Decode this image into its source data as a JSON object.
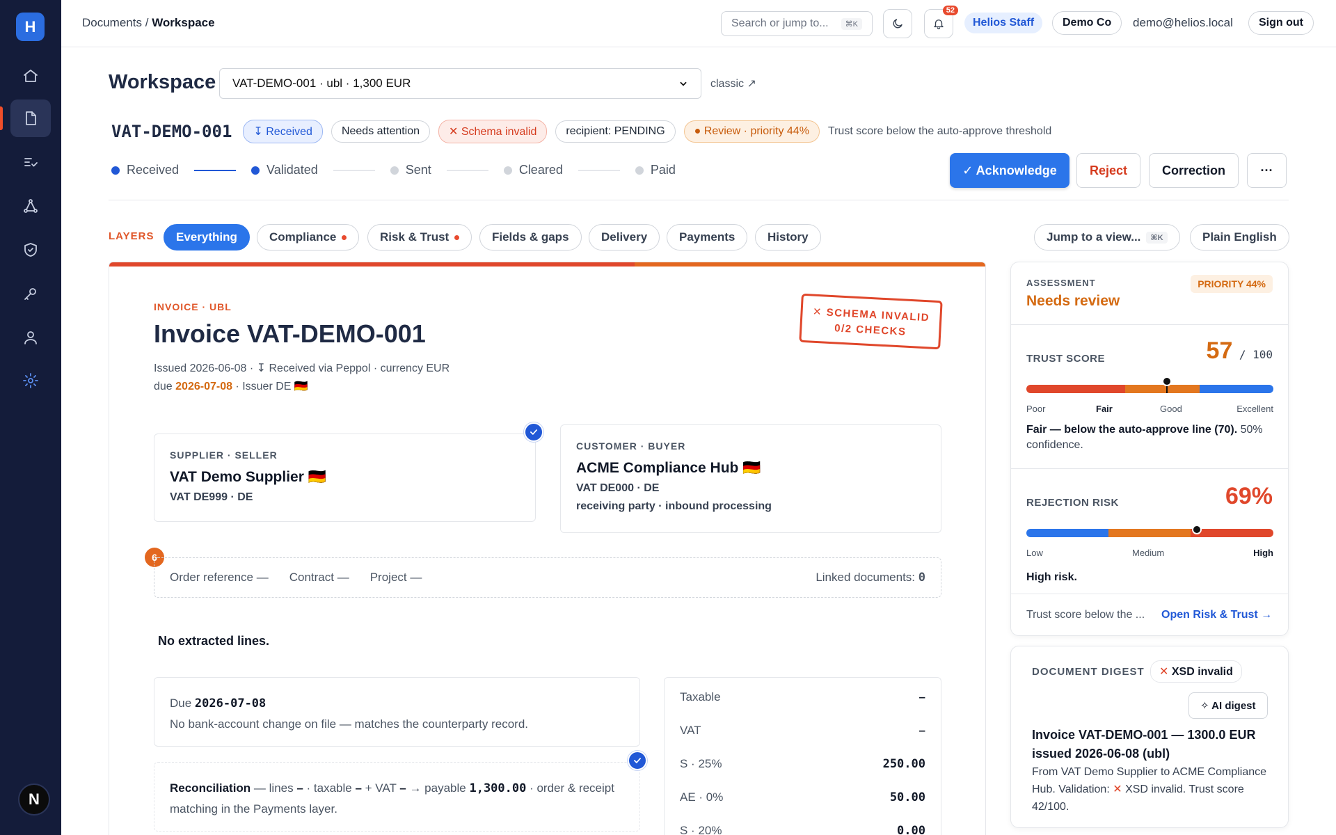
{
  "app": {
    "logo_letter": "H",
    "user_initial": "N"
  },
  "breadcrumb": {
    "parent": "Documents",
    "sep": "/",
    "current": "Workspace"
  },
  "topbar": {
    "search_placeholder": "Search or jump to...",
    "search_kbd": "⌘K",
    "notifications_count": "52",
    "staff_badge": "Helios Staff",
    "org": "Demo Co",
    "email": "demo@helios.local",
    "sign_out": "Sign out"
  },
  "workspace": {
    "title": "Workspace",
    "selected_doc": "VAT-DEMO-001 · ubl · 1,300 EUR",
    "classic_link": "classic ↗"
  },
  "document": {
    "id": "VAT-DEMO-001",
    "chips": {
      "received": "↧ Received",
      "needs_attention": "Needs attention",
      "schema_invalid": "✕ Schema invalid",
      "recipient": "recipient: PENDING",
      "review": "● Review · priority 44%"
    },
    "trust_note": "Trust score below the auto-approve threshold",
    "stages": [
      {
        "label": "Received",
        "done": true
      },
      {
        "label": "Validated",
        "done": true
      },
      {
        "label": "Sent",
        "done": false
      },
      {
        "label": "Cleared",
        "done": false
      },
      {
        "label": "Paid",
        "done": false
      }
    ],
    "actions": {
      "acknowledge": "✓ Acknowledge",
      "reject": "Reject",
      "correction": "Correction",
      "more": "···"
    }
  },
  "layers": {
    "label": "LAYERS",
    "tabs": [
      {
        "label": "Everything",
        "active": true
      },
      {
        "label": "Compliance",
        "alert": true
      },
      {
        "label": "Risk & Trust",
        "alert": true
      },
      {
        "label": "Fields & gaps"
      },
      {
        "label": "Delivery"
      },
      {
        "label": "Payments"
      },
      {
        "label": "History"
      }
    ],
    "jump": "Jump to a view...",
    "jump_kbd": "⌘K",
    "plain_english": "Plain English"
  },
  "invoice": {
    "type_label": "INVOICE · UBL",
    "title": "Invoice VAT-DEMO-001",
    "meta_line1": "Issued 2026-06-08 · ↧ Received via Peppol · currency EUR",
    "due_prefix": "due ",
    "due_date": "2026-07-08",
    "due_suffix": " · Issuer DE 🇩🇪",
    "stamp_line1": "✕ SCHEMA INVALID",
    "stamp_line2": "0/2 CHECKS",
    "supplier": {
      "label": "SUPPLIER · SELLER",
      "name": "VAT Demo Supplier 🇩🇪",
      "vat": "VAT DE999 · DE"
    },
    "customer": {
      "label": "CUSTOMER · BUYER",
      "name": "ACME Compliance Hub 🇩🇪",
      "vat": "VAT DE000 · DE",
      "note": "receiving party · inbound processing"
    },
    "gap_count": "6",
    "refs": {
      "order": "Order reference —",
      "contract": "Contract —",
      "project": "Project —",
      "linked_label": "Linked documents: ",
      "linked_count": "0"
    },
    "no_lines": "No extracted lines.",
    "due_box": {
      "label": "Due ",
      "date": "2026-07-08",
      "note": "No bank-account change on file — matches the counterparty record."
    },
    "reconciliation": {
      "label": "Reconciliation",
      "text1": " — lines ",
      "lines": "–",
      "text2": " · taxable ",
      "taxable": "–",
      "text3": " + VAT ",
      "vat": "–",
      "text4": " → payable ",
      "payable": "1,300.00",
      "text5": " · order & receipt matching in the Payments layer."
    },
    "totals": [
      {
        "label": "Taxable",
        "value": "–"
      },
      {
        "label": "VAT",
        "value": "–"
      },
      {
        "label": "S · 25%",
        "value": "250.00"
      },
      {
        "label": "AE · 0%",
        "value": "50.00"
      },
      {
        "label": "S · 20%",
        "value": "0.00"
      }
    ]
  },
  "assessment": {
    "label": "ASSESSMENT",
    "status": "Needs review",
    "priority": "PRIORITY 44%",
    "trust": {
      "label": "TRUST SCORE",
      "value": "57",
      "max": "/ 100",
      "position": 0.57,
      "scale": [
        "Poor",
        "Fair",
        "Good",
        "Excellent"
      ],
      "active_label": "Fair",
      "desc_bold": "Fair — below the auto-approve line (70).",
      "desc_rest": " 50% confidence."
    },
    "risk": {
      "label": "REJECTION RISK",
      "value": "69%",
      "position": 0.69,
      "scale": [
        "Low",
        "Medium",
        "High"
      ],
      "active_label": "High",
      "desc": "High risk."
    },
    "footer_note": "Trust score below the ...",
    "open_link": "Open Risk & Trust →"
  },
  "digest": {
    "label": "DOCUMENT DIGEST",
    "xsd_chip": "XSD invalid",
    "ai_button": "✧ AI digest",
    "title": "Invoice VAT-DEMO-001 — 1300.0 EUR issued 2026-06-08 (ubl)",
    "body_pre": "From VAT Demo Supplier to ACME Compliance Hub. Validation: ",
    "body_mark": "✕",
    "body_post": " XSD invalid. Trust score 42/100."
  },
  "colors": {
    "accent": "#2b75ea",
    "danger": "#e0472b",
    "warning": "#d46a12",
    "sidebar": "#141c3a"
  }
}
